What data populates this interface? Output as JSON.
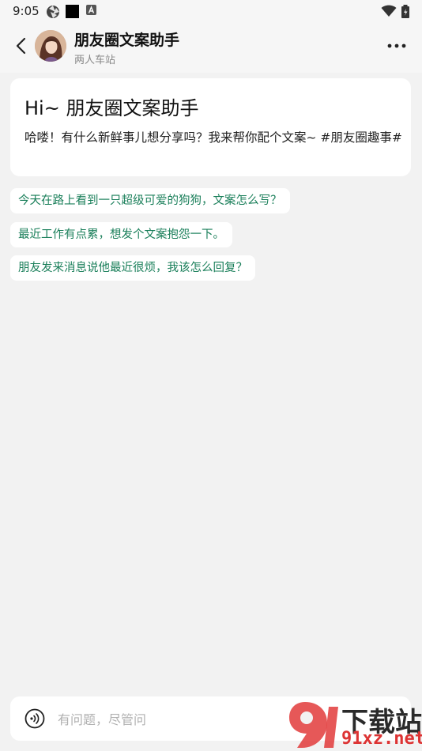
{
  "status_bar": {
    "time": "9:05"
  },
  "header": {
    "title": "朋友圈文案助手",
    "subtitle": "两人车站"
  },
  "intro": {
    "title": "Hi~ 朋友圈文案助手",
    "text": "哈喽！有什么新鲜事儿想分享吗？我来帮你配个文案~ #朋友圈趣事#"
  },
  "suggestions": [
    "今天在路上看到一只超级可爱的狗狗，文案怎么写？",
    "最近工作有点累，想发个文案抱怨一下。",
    "朋友发来消息说他最近很烦，我该怎么回复？"
  ],
  "input": {
    "placeholder": "有问题，尽管问"
  },
  "watermark": {
    "line1": "下载站",
    "line2": "91xz.net"
  },
  "colors": {
    "background": "#f2f2f2",
    "suggestion_text": "#1a7f5a",
    "watermark_red": "#dd3333"
  }
}
